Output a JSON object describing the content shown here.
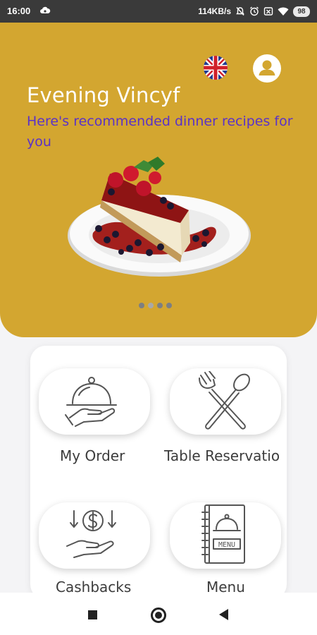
{
  "status_bar": {
    "time": "16:00",
    "network_speed": "114KB/s",
    "battery": "98",
    "icons": [
      "cloud-icon",
      "mute-icon",
      "alarm-icon",
      "sim-icon",
      "wifi-icon",
      "battery-icon"
    ]
  },
  "header": {
    "greeting": "Evening Vincyf",
    "subtitle": "Here's recommended dinner recipes for you",
    "language_icon": "uk-flag-icon",
    "profile_icon": "profile-icon",
    "carousel_pages": 4,
    "carousel_active_index": 1
  },
  "menu_tiles": [
    {
      "label": "My Order",
      "icon": "cloche-icon"
    },
    {
      "label": "Table Reservatio",
      "icon": "fork-spoon-icon"
    },
    {
      "label": "Cashbacks",
      "icon": "cashback-icon"
    },
    {
      "label": "Menu",
      "icon": "menu-book-icon"
    }
  ],
  "colors": {
    "hero_background": "#d3a630",
    "subtitle_text": "#5a32c8",
    "greeting_text": "#ffffff",
    "status_bar": "#3a3a3a"
  },
  "nav_bar": {
    "icons": [
      "recent-apps-icon",
      "home-icon",
      "back-icon"
    ]
  }
}
